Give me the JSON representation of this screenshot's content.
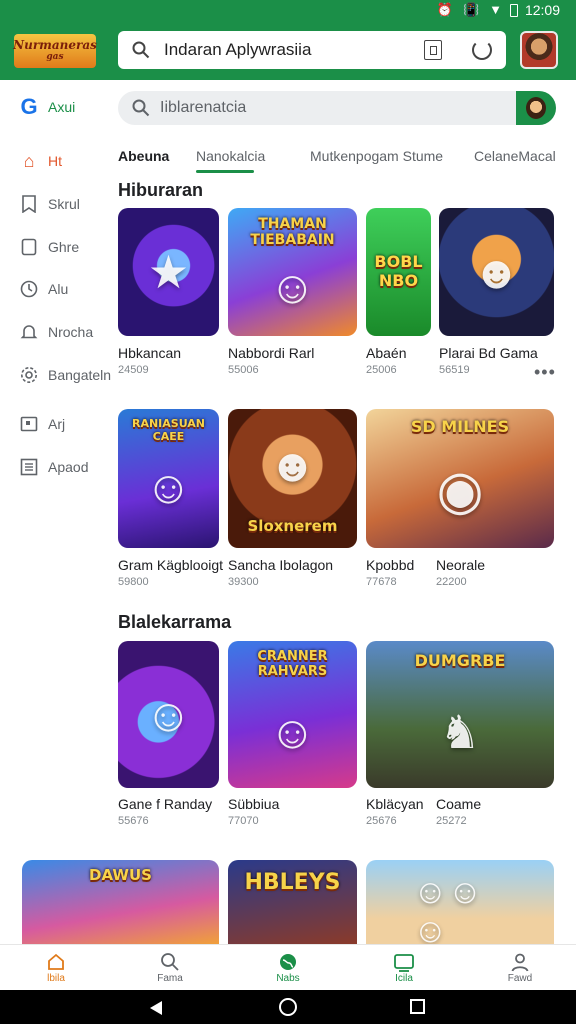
{
  "status": {
    "time": "12:09",
    "icons": [
      "alarm-icon",
      "vibrate-icon",
      "wifi-icon",
      "battery-icon"
    ]
  },
  "header": {
    "logo_text": "Nurmaneras",
    "logo_sub": "gas",
    "search_text": "Indaran Aplywrasiia",
    "accent_color": "#1b8f48"
  },
  "sidebar": {
    "items": [
      {
        "label": "Axui",
        "icon": "google-icon"
      },
      {
        "label": "Ht",
        "icon": "home-icon"
      },
      {
        "label": "Skrul",
        "icon": "bookmark-icon"
      },
      {
        "label": "Ghre",
        "icon": "doc-icon"
      },
      {
        "label": "Alu",
        "icon": "clock-icon"
      },
      {
        "label": "Nrocha",
        "icon": "bell-icon"
      },
      {
        "label": "Bangateln",
        "icon": "gear-icon"
      },
      {
        "label": "Arj",
        "icon": "square-icon"
      },
      {
        "label": "Apaod",
        "icon": "grid-icon"
      }
    ]
  },
  "search2": {
    "placeholder": "Iiblarenatcia"
  },
  "tabs": [
    "Abeuna",
    "Nanokalcia",
    "Mutkenpogam Stume",
    "CelaneMacal"
  ],
  "sections": [
    {
      "title": "Hiburaran"
    },
    {
      "title": "Blalekarrama"
    }
  ],
  "apps_row1": [
    {
      "name": "Hbkancan",
      "meta": "24509",
      "art": ""
    },
    {
      "name": "Nabbordi Rarl",
      "meta": "55006",
      "art": "THAMAN TIEBABAIN"
    },
    {
      "name": "Abaén",
      "meta": "25006",
      "art": "BOBL NBO"
    },
    {
      "name": "Plarai Bd Gama",
      "meta": "56519",
      "art": ""
    }
  ],
  "apps_row2": [
    {
      "name": "Gram Kägblooigt",
      "meta": "59800",
      "art": "RANIASUAN CAEE"
    },
    {
      "name": "Sancha Ibolagon",
      "meta": "39300",
      "art": "Sloxnerem"
    },
    {
      "name": "Kpobbd",
      "meta": "77678",
      "art": "SD MILNES"
    },
    {
      "name": "Neorale",
      "meta": "22200",
      "art": ""
    }
  ],
  "apps_row3": [
    {
      "name": "Gane f Randay",
      "meta": "55676",
      "art": ""
    },
    {
      "name": "Sübbiua",
      "meta": "77070",
      "art": "CRANNER RAHVARS"
    },
    {
      "name": "Kbläcyan",
      "meta": "25676",
      "art": "DUMGRBE"
    },
    {
      "name": "Coame",
      "meta": "25272",
      "art": ""
    }
  ],
  "apps_row4": [
    {
      "name": "",
      "meta": "",
      "art": "DAWUS"
    },
    {
      "name": "",
      "meta": "",
      "art": "HBLEYS"
    },
    {
      "name": "",
      "meta": "",
      "art": ""
    }
  ],
  "bottom_nav": [
    {
      "label": "lbila",
      "icon": "home-icon"
    },
    {
      "label": "Fama",
      "icon": "search-icon"
    },
    {
      "label": "Nabs",
      "icon": "globe-icon"
    },
    {
      "label": "Icila",
      "icon": "tablet-icon"
    },
    {
      "label": "Fawd",
      "icon": "person-icon"
    }
  ]
}
